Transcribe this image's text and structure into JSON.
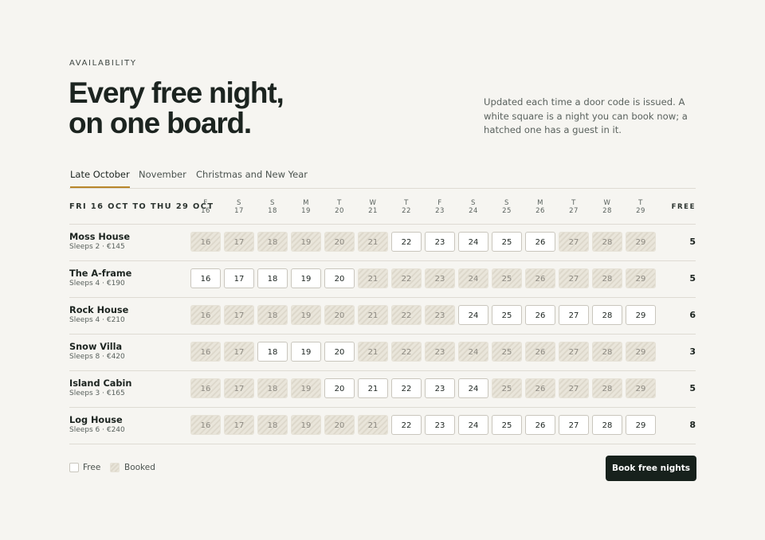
{
  "eyebrow": "AVAILABILITY",
  "headline": {
    "line1": "Every free night,",
    "line2": "on one board."
  },
  "intro": "Updated each time a door code is issued. A white square is a night you can book now; a hatched one has a guest in it.",
  "tabs": [
    {
      "label": "Late October",
      "active": true
    },
    {
      "label": "November",
      "active": false
    },
    {
      "label": "Christmas and New Year",
      "active": false
    }
  ],
  "range_label": "FRI 16 OCT TO THU 29 OCT",
  "free_header": "FREE",
  "days": [
    {
      "dow": "F",
      "date": "16"
    },
    {
      "dow": "S",
      "date": "17"
    },
    {
      "dow": "S",
      "date": "18"
    },
    {
      "dow": "M",
      "date": "19"
    },
    {
      "dow": "T",
      "date": "20"
    },
    {
      "dow": "W",
      "date": "21"
    },
    {
      "dow": "T",
      "date": "22"
    },
    {
      "dow": "F",
      "date": "23"
    },
    {
      "dow": "S",
      "date": "24"
    },
    {
      "dow": "S",
      "date": "25"
    },
    {
      "dow": "M",
      "date": "26"
    },
    {
      "dow": "T",
      "date": "27"
    },
    {
      "dow": "W",
      "date": "28"
    },
    {
      "dow": "T",
      "date": "29"
    }
  ],
  "properties": [
    {
      "name": "Moss House",
      "meta": "Sleeps 2 · €145",
      "free": "5",
      "nights": [
        "booked",
        "booked",
        "booked",
        "booked",
        "booked",
        "booked",
        "free",
        "free",
        "free",
        "free",
        "free",
        "booked",
        "booked",
        "booked"
      ]
    },
    {
      "name": "The A-frame",
      "meta": "Sleeps 4 · €190",
      "free": "5",
      "nights": [
        "free",
        "free",
        "free",
        "free",
        "free",
        "booked",
        "booked",
        "booked",
        "booked",
        "booked",
        "booked",
        "booked",
        "booked",
        "booked"
      ]
    },
    {
      "name": "Rock House",
      "meta": "Sleeps 4 · €210",
      "free": "6",
      "nights": [
        "booked",
        "booked",
        "booked",
        "booked",
        "booked",
        "booked",
        "booked",
        "booked",
        "free",
        "free",
        "free",
        "free",
        "free",
        "free"
      ]
    },
    {
      "name": "Snow Villa",
      "meta": "Sleeps 8 · €420",
      "free": "3",
      "nights": [
        "booked",
        "booked",
        "free",
        "free",
        "free",
        "booked",
        "booked",
        "booked",
        "booked",
        "booked",
        "booked",
        "booked",
        "booked",
        "booked"
      ]
    },
    {
      "name": "Island Cabin",
      "meta": "Sleeps 3 · €165",
      "free": "5",
      "nights": [
        "booked",
        "booked",
        "booked",
        "booked",
        "free",
        "free",
        "free",
        "free",
        "free",
        "booked",
        "booked",
        "booked",
        "booked",
        "booked"
      ]
    },
    {
      "name": "Log House",
      "meta": "Sleeps 6 · €240",
      "free": "8",
      "nights": [
        "booked",
        "booked",
        "booked",
        "booked",
        "booked",
        "booked",
        "free",
        "free",
        "free",
        "free",
        "free",
        "free",
        "free",
        "free"
      ]
    }
  ],
  "legend": {
    "free": "Free",
    "booked": "Booked"
  },
  "cta_label": "Book free nights",
  "colors": {
    "accent": "#b8862a",
    "ink": "#1c2420",
    "background": "#f6f5f1",
    "button": "#17211c"
  }
}
